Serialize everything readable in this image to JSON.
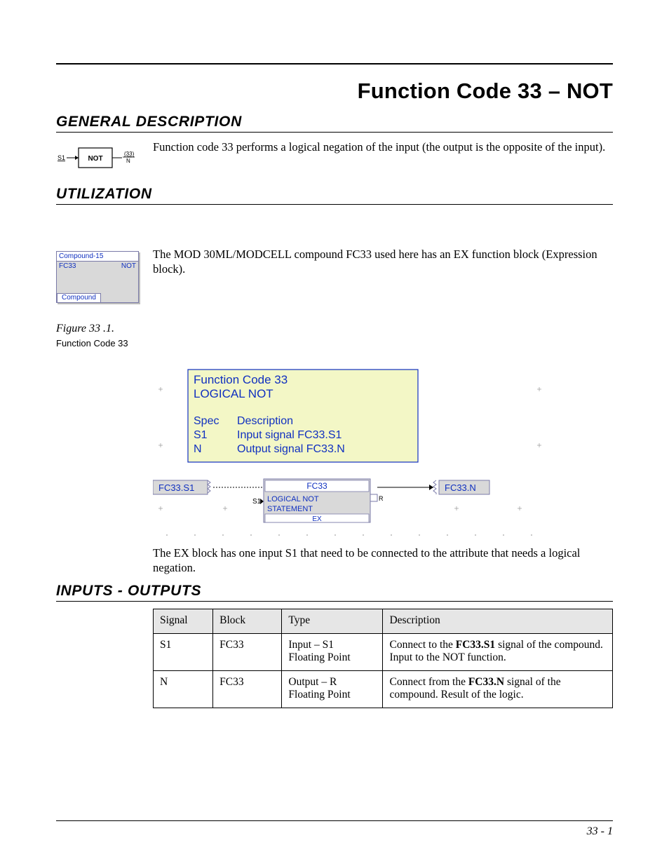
{
  "title": "Function Code 33 – NOT",
  "sections": {
    "general": {
      "heading": "GENERAL DESCRIPTION",
      "text": "Function code 33 performs a logical negation of the input (the output is the opposite of the input).",
      "symbol": {
        "s1": "S1",
        "not": "NOT",
        "code": "(33)",
        "n": "N"
      }
    },
    "utilization": {
      "heading": "UTILIZATION",
      "text1": "The MOD 30ML/MODCELL compound FC33 used here has an EX function block (Expression block).",
      "thumb": {
        "title": "Compound-15",
        "fc": "FC33",
        "name": "NOT",
        "tab": "Compound"
      },
      "figure_label": "Figure 33 .1.",
      "figure_sub": "Function Code 33",
      "diagram": {
        "box_title1": "Function Code 33",
        "box_title2": "LOGICAL NOT",
        "spec": "Spec",
        "desc": "Description",
        "s1": "S1",
        "s1_desc": "Input signal FC33.S1",
        "n": "N",
        "n_desc": "Output signal FC33.N",
        "tag_in": "FC33.S1",
        "tag_out": "FC33.N",
        "block_name": "FC33",
        "block_line2": "LOGICAL NOT",
        "block_line3": "STATEMENT",
        "block_kind": "EX",
        "s_label": "S1",
        "r_label": "R"
      },
      "text2": "The EX block has one input S1 that need to be connected to the attribute that needs a logical negation."
    },
    "io": {
      "heading": "INPUTS - OUTPUTS",
      "headers": [
        "Signal",
        "Block",
        "Type",
        "Description"
      ],
      "rows": [
        {
          "signal": "S1",
          "block": "FC33",
          "type_l1": "Input – S1",
          "type_l2": "Floating Point",
          "desc_pre": "Connect to the ",
          "desc_b": "FC33.S1",
          "desc_post": " signal of the compound. Input to the NOT function."
        },
        {
          "signal": "N",
          "block": "FC33",
          "type_l1": "Output – R",
          "type_l2": "Floating Point",
          "desc_pre": "Connect from the ",
          "desc_b": "FC33.N",
          "desc_post": " signal of the compound. Result of the logic."
        }
      ]
    }
  },
  "footer": "33 - 1"
}
